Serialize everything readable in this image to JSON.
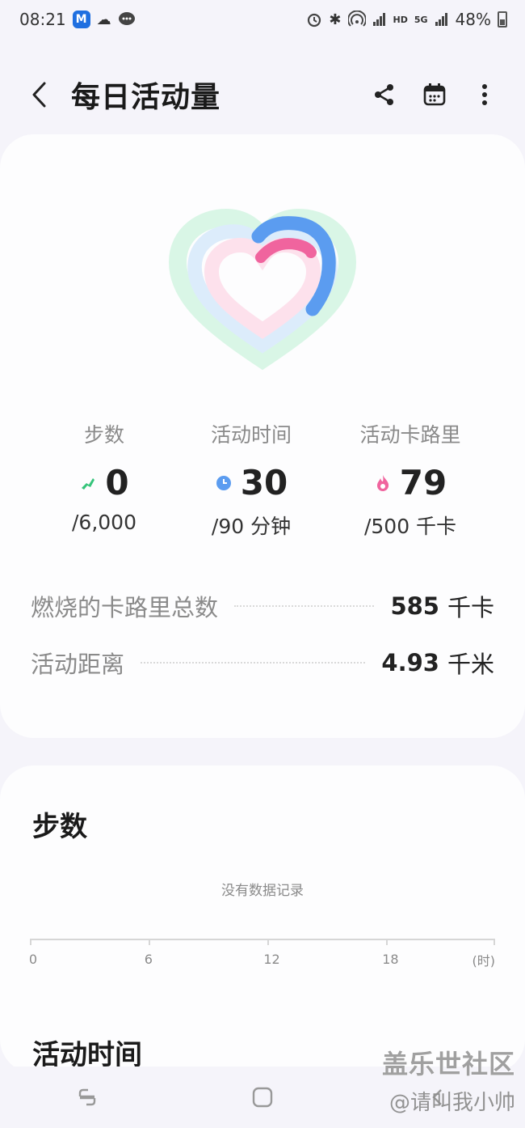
{
  "status_bar": {
    "time": "08:21",
    "battery": "48%",
    "app_badge_letter": "M",
    "network_hd": "HD",
    "network_5g": "5G"
  },
  "header": {
    "title": "每日活动量",
    "icons": [
      "back-icon",
      "share-icon",
      "calendar-icon",
      "more-icon"
    ]
  },
  "summary": {
    "rings": {
      "steps_progress": 0,
      "active_time_progress": 0.333,
      "calories_progress": 0.158
    },
    "colors": {
      "steps": "#35c47a",
      "active_time": "#5b9cf0",
      "calories": "#f0649e"
    },
    "metrics": [
      {
        "label": "步数",
        "value": "0",
        "goal": "/6,000",
        "icon": "shoe-icon"
      },
      {
        "label": "活动时间",
        "value": "30",
        "goal": "/90 分钟",
        "icon": "clock-icon"
      },
      {
        "label": "活动卡路里",
        "value": "79",
        "goal": "/500 千卡",
        "icon": "flame-icon"
      }
    ],
    "stats": [
      {
        "label": "燃烧的卡路里总数",
        "value": "585",
        "unit": "千卡"
      },
      {
        "label": "活动距离",
        "value": "4.93",
        "unit": "千米"
      }
    ]
  },
  "steps_section": {
    "title": "步数",
    "empty_text": "没有数据记录",
    "axis_labels": [
      "0",
      "6",
      "12",
      "18"
    ],
    "axis_unit": "(时)"
  },
  "active_time_section": {
    "title": "活动时间"
  },
  "nav": {
    "icons": [
      "recents-icon",
      "home-icon"
    ]
  },
  "watermark": {
    "line1": "盖乐世社区",
    "line2": "@请叫我小帅"
  }
}
